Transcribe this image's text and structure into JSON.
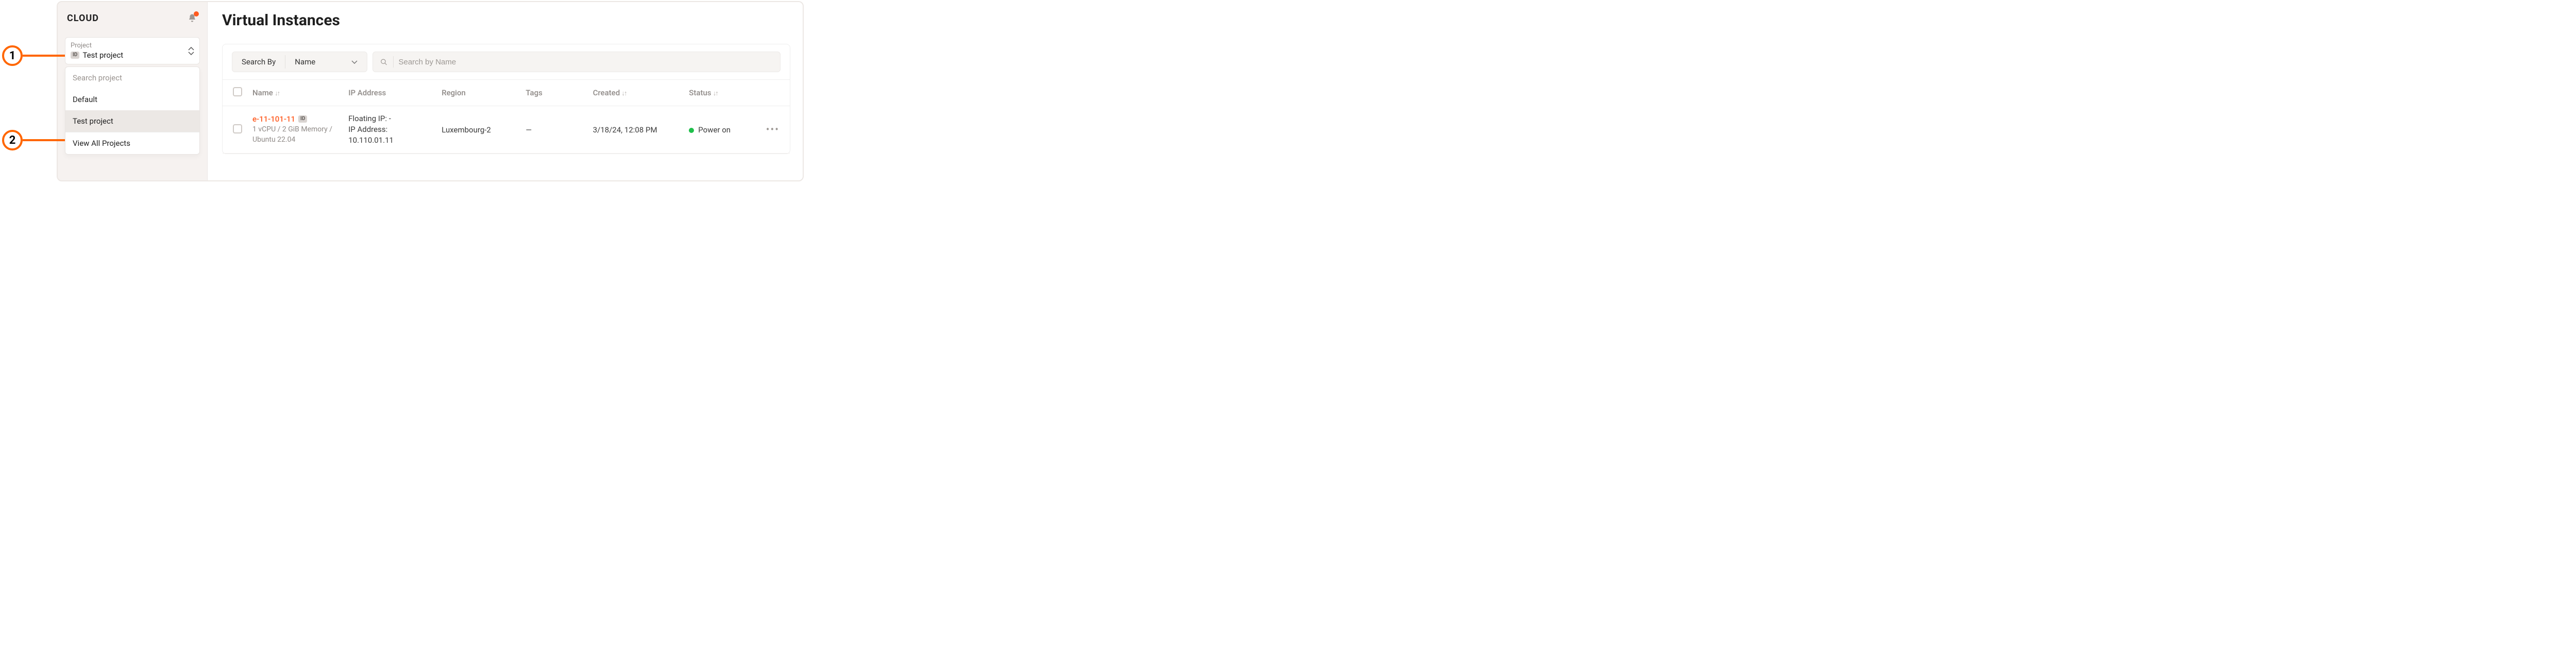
{
  "annotations": {
    "one": "1",
    "two": "2"
  },
  "sidebar": {
    "brand": "CLOUD",
    "project_label": "Project",
    "project_value": "Test project",
    "id_badge": "ID",
    "dropdown": {
      "search_placeholder": "Search project",
      "items": [
        {
          "label": "Default"
        },
        {
          "label": "Test project"
        }
      ],
      "view_all_label": "View All Projects"
    }
  },
  "main": {
    "title": "Virtual Instances",
    "filter": {
      "search_by_label": "Search By",
      "field_label": "Name",
      "search_placeholder": "Search by Name"
    },
    "table": {
      "headers": {
        "name": "Name",
        "ip": "IP Address",
        "region": "Region",
        "tags": "Tags",
        "created": "Created",
        "status": "Status"
      },
      "rows": [
        {
          "name": "e-11-101-11",
          "id_badge": "ID",
          "spec": "1 vCPU / 2 GiB Memory / Ubuntu 22.04",
          "ip_floating_label": "Floating IP: -",
          "ip_address_label": "IP Address:",
          "ip_address_value": "10.110.01.11",
          "region": "Luxembourg-2",
          "tags": "—",
          "created": "3/18/24, 12:08 PM",
          "status": "Power on"
        }
      ]
    }
  }
}
